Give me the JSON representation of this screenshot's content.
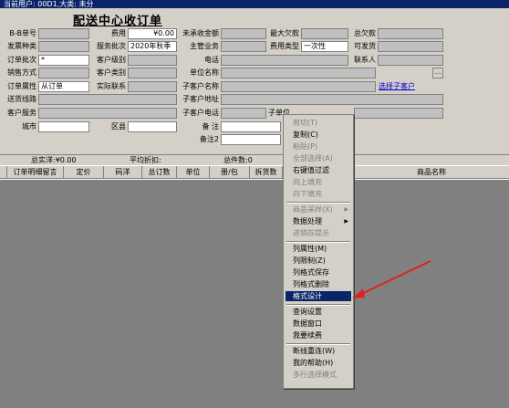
{
  "window": {
    "title": "当前用户: 00D1,大类: 未分"
  },
  "form": {
    "title": "配送中心收订单",
    "labels": {
      "bb_no": "B-B单号",
      "invoice_type": "发票种类",
      "order_batch": "订单批次",
      "sales_mode": "销售方式",
      "order_attr": "订单属性",
      "warehouse": "送货线路",
      "customer_service": "客户服务",
      "city": "城市",
      "fee": "费用",
      "service_batch": "服务批次",
      "customer_level": "客户级别",
      "customer_type": "客户类别",
      "actual_contact": "实际联系",
      "district": "区县",
      "unrecv_amount": "未承收金额",
      "main_business": "主管业务",
      "phone": "电话",
      "unit_name": "单位名称",
      "sub_customer_name": "子客户名称",
      "sub_customer_addr": "子客户地址",
      "sub_customer_phone": "子客户电话",
      "note": "备 注",
      "note2": "备注2",
      "sub_unit": "子单位",
      "max_owed": "最大欠款",
      "fee_type": "费用类型",
      "total_owed": "总欠款",
      "deliverable": "可发货",
      "contact": "联系人"
    },
    "values": {
      "fee": "¥0.00",
      "service_batch": "2020年秋季",
      "order_batch": "*",
      "order_attr": "从订单",
      "fee_type": "一次性"
    },
    "select_customer_link": "选择子客户",
    "browse_button": "..."
  },
  "summary": {
    "total_real": "总实洋:¥0.00",
    "avg_discount": "平均折扣:",
    "total_count": "总件数:0"
  },
  "grid_headers": [
    "订单明细留言",
    "定价",
    "码洋",
    "总订数",
    "单位",
    "册/包",
    "拆货数",
    "商品名称"
  ],
  "context_menu": {
    "items": [
      {
        "label": "剪切(T)",
        "disabled": true
      },
      {
        "label": "复制(C)",
        "disabled": false
      },
      {
        "label": "粘贴(P)",
        "disabled": true
      },
      {
        "label": "全部选择(A)",
        "disabled": true
      },
      {
        "label": "右键值过滤",
        "disabled": false
      },
      {
        "label": "向上填充",
        "disabled": true
      },
      {
        "label": "向下填充",
        "disabled": true
      },
      {
        "label": "商品采样(X)",
        "disabled": true,
        "submenu": true
      },
      {
        "label": "数据处理",
        "disabled": false,
        "submenu": true
      },
      {
        "label": "进销存提示",
        "disabled": true
      },
      {
        "label": "列属性(M)",
        "disabled": false
      },
      {
        "label": "列限制(Z)",
        "disabled": false
      },
      {
        "label": "列格式保存",
        "disabled": false
      },
      {
        "label": "列格式删除",
        "disabled": false
      },
      {
        "label": "格式设计",
        "disabled": false,
        "selected": true
      },
      {
        "label": "查询设置",
        "disabled": false
      },
      {
        "label": "数据窗口",
        "disabled": false
      },
      {
        "label": "我要续费",
        "disabled": false
      },
      {
        "label": "断线重连(W)",
        "disabled": false
      },
      {
        "label": "我的帮助(H)",
        "disabled": false
      },
      {
        "label": "多行选择模式",
        "disabled": true
      }
    ]
  },
  "colors": {
    "highlight": "#0a246a",
    "arrow": "#e02020",
    "panel": "#d4d0c8"
  }
}
